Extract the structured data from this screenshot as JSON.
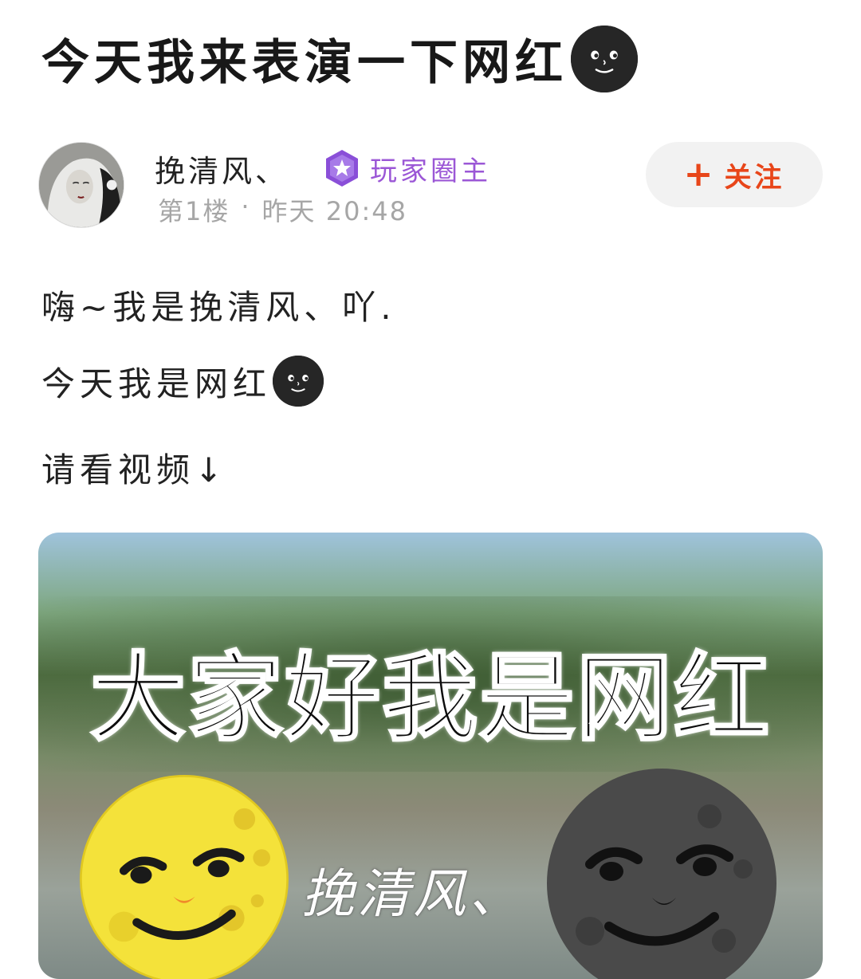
{
  "post": {
    "title": "今天我来表演一下网红",
    "title_emoji": "new-moon-face-icon"
  },
  "author": {
    "name": "挽清风、",
    "badge_label": "玩家圈主",
    "badge_icon": "star-hexagon-icon",
    "floor": "第1楼",
    "separator": "·",
    "time": "昨天 20:48",
    "follow_label": "关注",
    "follow_icon": "plus-icon"
  },
  "content": {
    "lines": [
      "嗨~我是挽清风、吖.",
      "今天我是网红",
      "请看视频↓"
    ],
    "line2_emoji": "new-moon-face-icon"
  },
  "video": {
    "caption": "大家好我是网红",
    "watermark": "挽清风、"
  },
  "colors": {
    "accent_follow": "#e8461a",
    "badge_purple": "#9b57d6",
    "meta_gray": "#a6a6a6"
  }
}
